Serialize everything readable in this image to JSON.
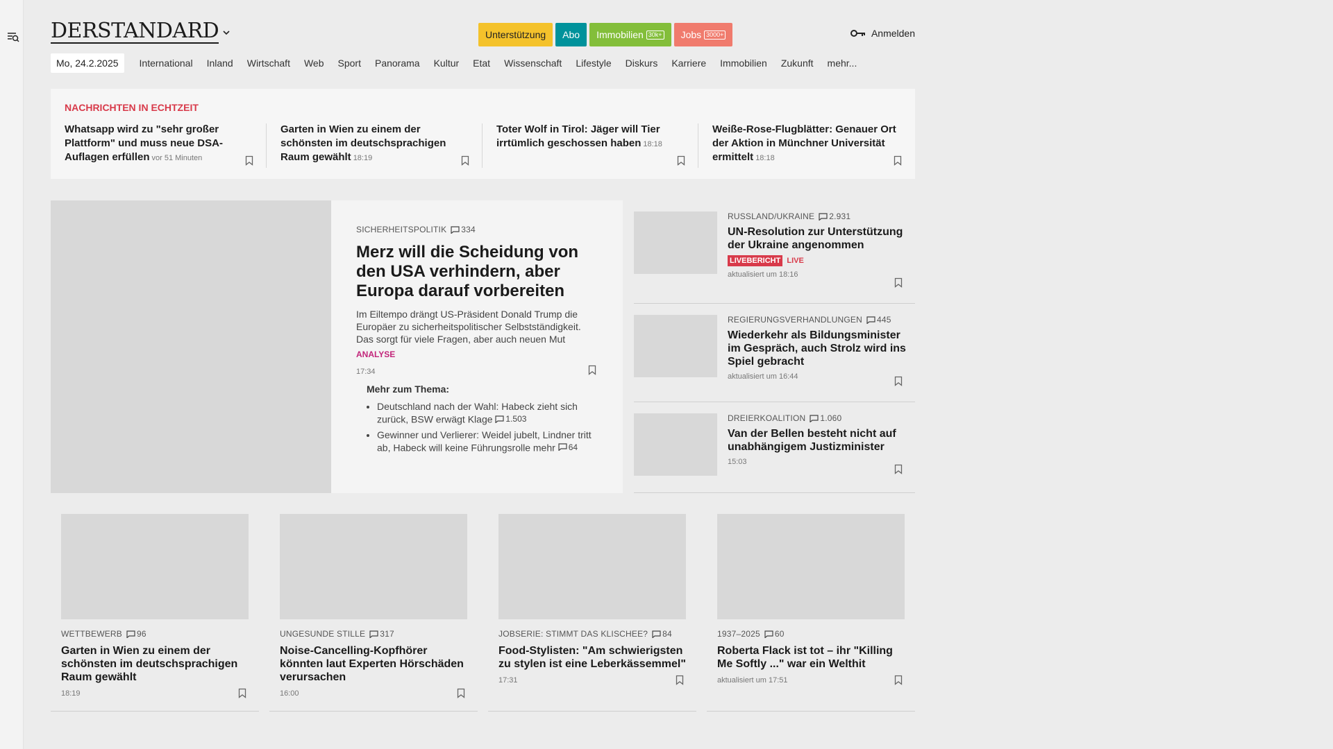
{
  "header": {
    "logo": "DERSTANDARD",
    "pills": [
      {
        "label": "Unterstützung",
        "badge": ""
      },
      {
        "label": "Abo",
        "badge": ""
      },
      {
        "label": "Immobilien",
        "badge": "30k+"
      },
      {
        "label": "Jobs",
        "badge": "3000+"
      }
    ],
    "login_label": "Anmelden"
  },
  "nav": {
    "date": "Mo, 24.2.2025",
    "items": [
      "International",
      "Inland",
      "Wirtschaft",
      "Web",
      "Sport",
      "Panorama",
      "Kultur",
      "Etat",
      "Wissenschaft",
      "Lifestyle",
      "Diskurs",
      "Karriere",
      "Immobilien",
      "Zukunft",
      "mehr..."
    ]
  },
  "ticker": {
    "title": "NACHRICHTEN IN ECHTZEIT",
    "items": [
      {
        "headline": "Whatsapp wird zu \"sehr großer Plattform\" und muss neue DSA-Auflagen erfüllen",
        "time": "vor 51 Minuten"
      },
      {
        "headline": "Garten in Wien zu einem der schönsten im deutschsprachigen Raum gewählt",
        "time": "18:19"
      },
      {
        "headline": "Toter Wolf in Tirol: Jäger will Tier irrtümlich geschossen haben",
        "time": "18:18"
      },
      {
        "headline": "Weiße-Rose-Flugblätter: Genauer Ort der Aktion in Münchner Universität ermittelt",
        "time": "18:18"
      }
    ]
  },
  "hero": {
    "kicker": "SICHERHEITSPOLITIK",
    "comments": "334",
    "title": "Merz will die Scheidung von den USA verhindern, aber Europa darauf vorbereiten",
    "lead": "Im Eiltempo drängt US-Präsident Donald Trump die Europäer zu sicherheitspolitischer Selbstständigkeit. Das sorgt für viele Fragen, aber auch neuen Mut",
    "tag": "ANALYSE",
    "time": "17:34",
    "more_title": "Mehr zum Thema:",
    "more": [
      {
        "text": "Deutschland nach der Wahl: Habeck zieht sich zurück, BSW erwägt Klage",
        "comments": "1.503"
      },
      {
        "text": "Gewinner und Verlierer: Weidel jubelt, Lindner tritt ab, Habeck will keine Führungsrolle mehr",
        "comments": "64"
      }
    ]
  },
  "side": [
    {
      "kicker": "RUSSLAND/UKRAINE",
      "comments": "2.931",
      "title": "UN-Resolution zur Unterstützung der Ukraine angenommen",
      "live_label": "LIVEBERICHT",
      "live_text": "LIVE",
      "meta": "aktualisiert um 18:16"
    },
    {
      "kicker": "REGIERUNGSVERHANDLUNGEN",
      "comments": "445",
      "title": "Wiederkehr als Bildungsminister im Gespräch, auch Strolz wird ins Spiel gebracht",
      "meta": "aktualisiert um 16:44"
    },
    {
      "kicker": "DREIERKOALITION",
      "comments": "1.060",
      "title": "Van der Bellen besteht nicht auf unabhängigem Justizminister",
      "meta": "15:03"
    }
  ],
  "cards": [
    {
      "kicker": "WETTBEWERB",
      "comments": "96",
      "title": "Garten in Wien zu einem der schönsten im deutschsprachigen Raum gewählt",
      "meta": "18:19"
    },
    {
      "kicker": "UNGESUNDE STILLE",
      "comments": "317",
      "title": "Noise-Cancelling-Kopfhörer könnten laut Experten Hörschäden verursachen",
      "meta": "16:00"
    },
    {
      "kicker": "JOBSERIE: STIMMT DAS KLISCHEE?",
      "comments": "84",
      "title": "Food-Stylisten: \"Am schwierigsten zu stylen ist eine Leberkässemmel\"",
      "meta": "17:31"
    },
    {
      "kicker": "1937–2025",
      "comments": "60",
      "title": "Roberta Flack ist tot – ihr \"Killing Me Softly ...\" war ein Welthit",
      "meta": "aktualisiert um 17:51"
    }
  ],
  "icons": {
    "bookmark": "bookmark-icon",
    "comment": "comment-icon",
    "key": "key-icon",
    "menu": "menu-search-icon"
  }
}
